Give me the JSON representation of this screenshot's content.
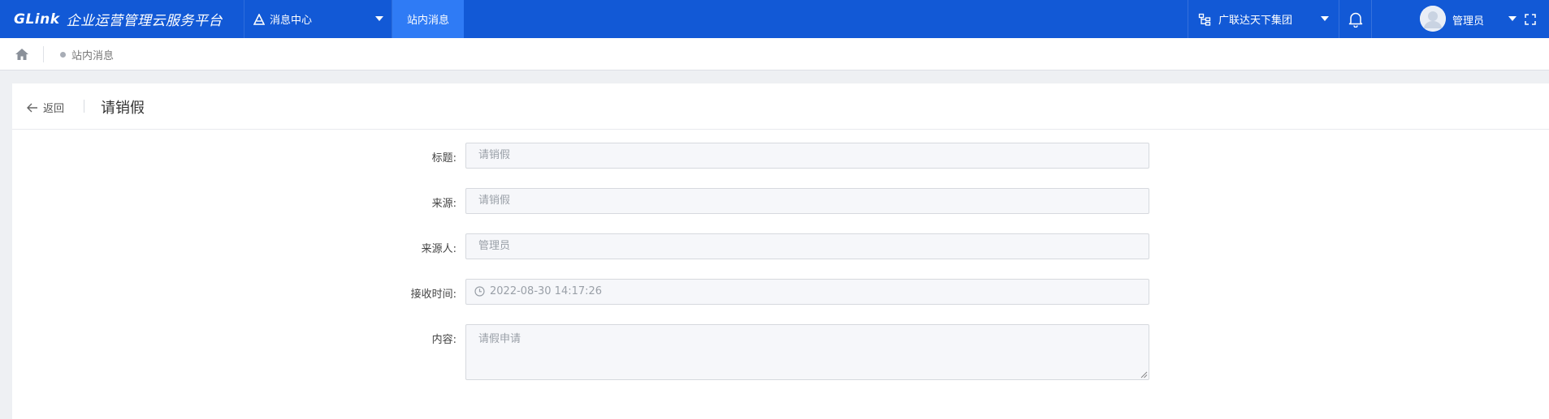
{
  "header": {
    "logo": "GLink",
    "platform_name": "企业运营管理云服务平台",
    "module": "消息中心",
    "active_tab": "站内消息",
    "organization": "广联达天下集团",
    "user_name": "管理员"
  },
  "breadcrumb": {
    "current": "站内消息"
  },
  "page": {
    "back_label": "返回",
    "title": "请销假"
  },
  "form": {
    "title_label": "标题:",
    "title_value": "请销假",
    "source_label": "来源:",
    "source_value": "请销假",
    "source_person_label": "来源人:",
    "source_person_value": "管理员",
    "receive_time_label": "接收时间:",
    "receive_time_value": "2022-08-30 14:17:26",
    "content_label": "内容:",
    "content_value": "请假申请"
  },
  "colors": {
    "header_bg": "#1259d6",
    "tab_active_bg": "#2f7bf5",
    "page_bg": "#eef0f3",
    "input_bg": "#f6f7fa"
  }
}
